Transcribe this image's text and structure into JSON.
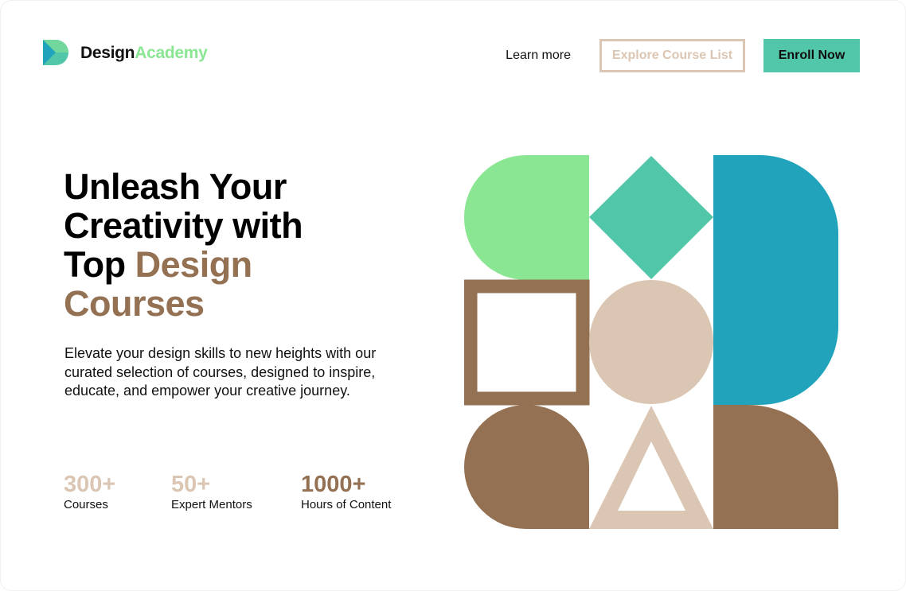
{
  "brand": {
    "name_part1": "Design",
    "name_part2": "Academy",
    "logo_icon": "logo-d-icon"
  },
  "nav": {
    "learn_more": "Learn more",
    "explore": "Explore Course List",
    "enroll": "Enroll Now"
  },
  "hero": {
    "title_line1": "Unleash Your",
    "title_line2": "Creativity with",
    "title_line3_plain": "Top ",
    "title_line3_highlight": "Design",
    "title_line4_highlight": "Courses",
    "description": "Elevate your design skills to new heights with our curated selection of courses, designed to inspire, educate, and empower your creative journey."
  },
  "stats": [
    {
      "value": "300+",
      "label": "Courses",
      "color": "#DBC6B3"
    },
    {
      "value": "50+",
      "label": "Expert Mentors",
      "color": "#DBC6B3"
    },
    {
      "value": "1000+",
      "label": "Hours of Content",
      "color": "#937152"
    }
  ],
  "colors": {
    "light_green": "#8AE692",
    "teal": "#52C6A8",
    "blue": "#21A3BC",
    "brown": "#937152",
    "beige": "#DBC6B3"
  }
}
